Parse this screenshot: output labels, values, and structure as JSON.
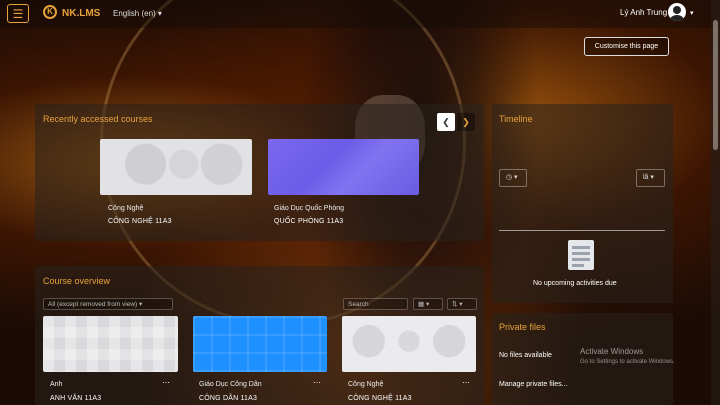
{
  "navbar": {
    "menu_icon": "hamburger-icon",
    "logo_icon": "logo-k-icon",
    "site_name": "NK.LMS",
    "language": "English (en) ▾",
    "user_name": "Lý Anh Trung",
    "avatar_icon": "user-avatar-icon"
  },
  "customise_label": "Customise this page",
  "recent": {
    "title": "Recently accessed courses",
    "prev_icon": "chevron-left-icon",
    "next_icon": "chevron-right-icon",
    "courses": [
      {
        "category": "Công Nghệ",
        "name": "CÔNG NGHỆ 11A3"
      },
      {
        "category": "Giáo Dục Quốc Phòng",
        "name": "QUỐC PHÒNG 11A3"
      }
    ]
  },
  "timeline": {
    "title": "Timeline",
    "sort_value": "lâ ▾",
    "filter_icon": "clock-icon",
    "empty_text": "No upcoming activities due"
  },
  "overview": {
    "title": "Course overview",
    "filter_placeholder": "All (except removed from view) ▾",
    "search_placeholder": "Search",
    "courses": [
      {
        "category": "Anh",
        "name": "ANH VĂN 11A3"
      },
      {
        "category": "Giáo Dục Công Dân",
        "name": "CÔNG DÂN 11A3"
      },
      {
        "category": "Công Nghệ",
        "name": "CÔNG NGHỆ 11A3"
      }
    ],
    "more_label": "⋯"
  },
  "private_files": {
    "title": "Private files",
    "empty_text": "No files available",
    "manage_link": "Manage private files..."
  },
  "watermark": {
    "line1": "Activate Windows",
    "line2": "Go to Settings to activate Windows."
  },
  "colors": {
    "accent": "#e8a33c"
  }
}
